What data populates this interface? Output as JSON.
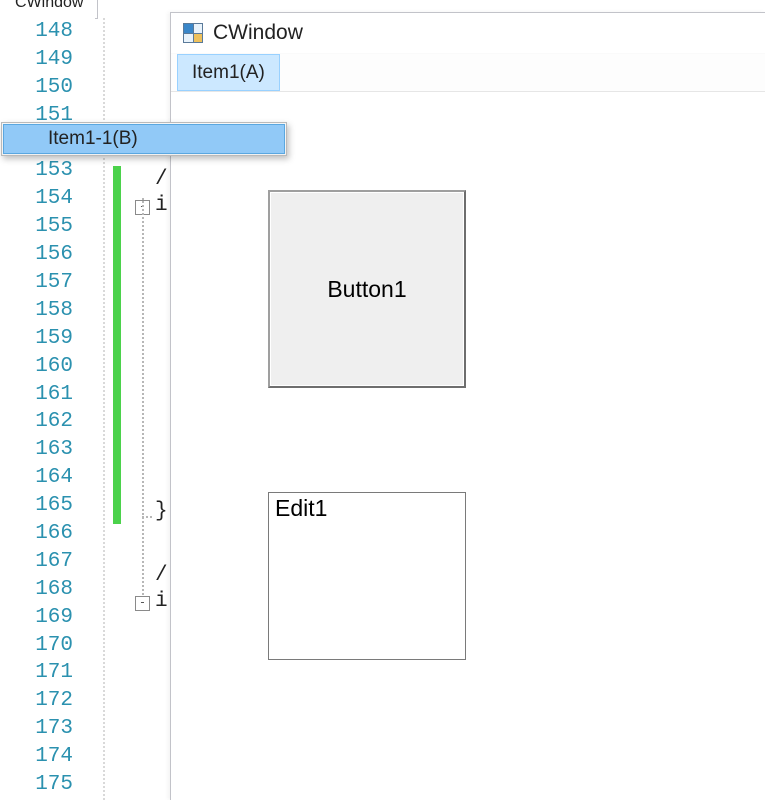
{
  "editor_tab_label": "CWindow",
  "gutter": {
    "start": 148,
    "end": 175
  },
  "code_fragments": {
    "slash": "/",
    "char_i1": "i",
    "brace_close": "}",
    "char_i2": "i"
  },
  "fold_minus": "-",
  "window": {
    "title": "CWindow",
    "menu": {
      "items": [
        "Item1(A)"
      ],
      "active_index": 0,
      "submenu": [
        "Item1-1(B)"
      ]
    },
    "button_label": "Button1",
    "edit_value": "Edit1"
  }
}
